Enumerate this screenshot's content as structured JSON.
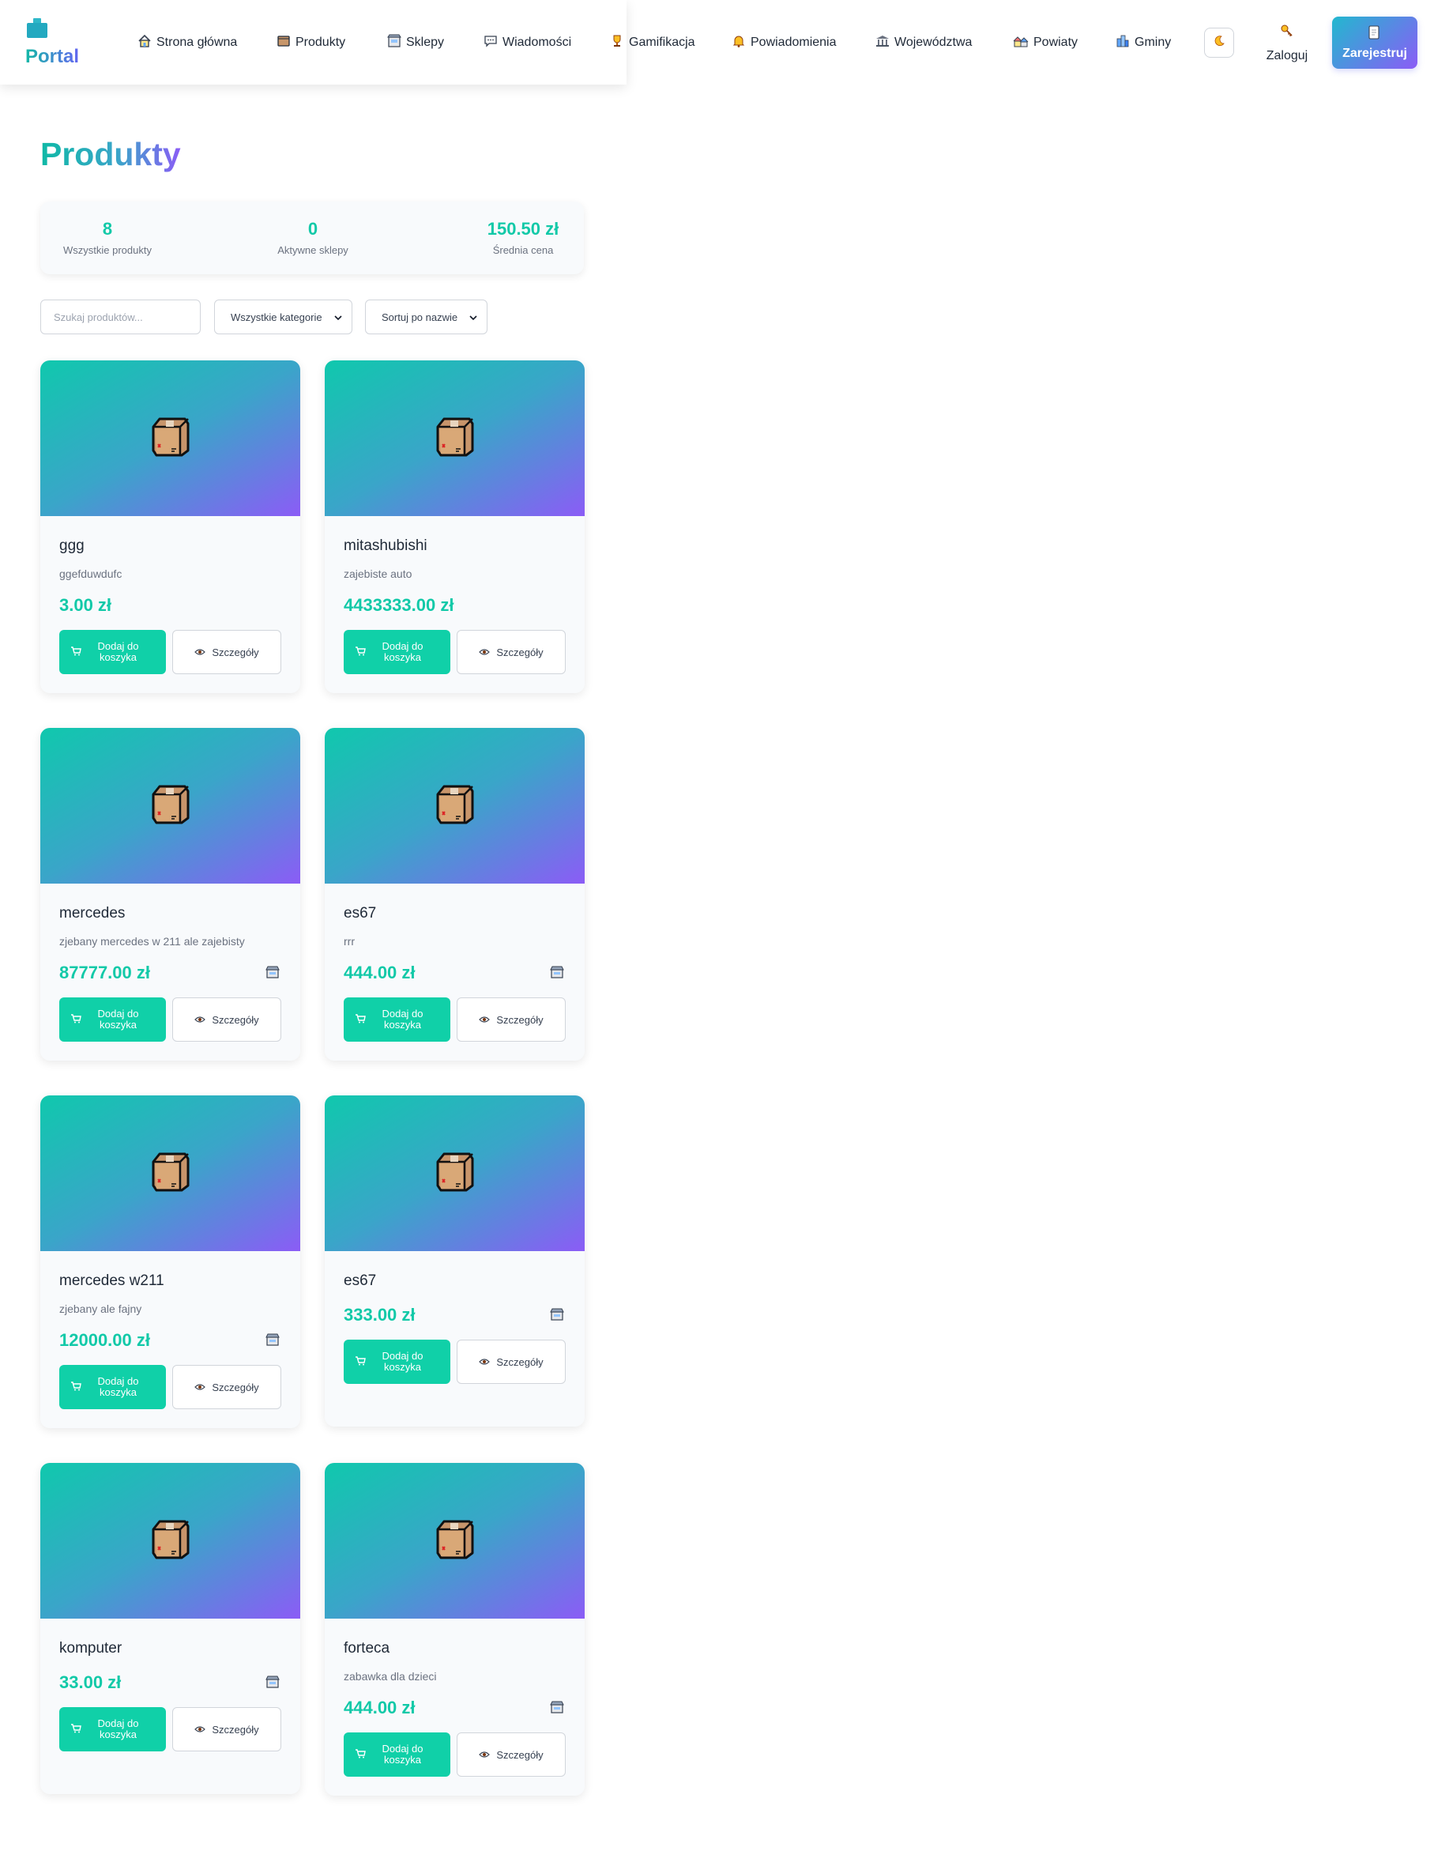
{
  "header": {
    "logo_text": "Portal",
    "nav": [
      {
        "label": "Strona główna",
        "icon": "home-icon"
      },
      {
        "label": "Produkty",
        "icon": "package-icon"
      },
      {
        "label": "Sklepy",
        "icon": "shop-icon"
      },
      {
        "label": "Wiadomości",
        "icon": "chat-icon"
      },
      {
        "label": "Gamifikacja",
        "icon": "trophy-icon"
      },
      {
        "label": "Powiadomienia",
        "icon": "bell-icon"
      },
      {
        "label": "Województwa",
        "icon": "bank-icon"
      },
      {
        "label": "Powiaty",
        "icon": "houses-icon"
      },
      {
        "label": "Gminy",
        "icon": "city-icon"
      }
    ],
    "theme_icon": "moon-icon",
    "login_label": "Zaloguj",
    "register_label": "Zarejestruj"
  },
  "page": {
    "title": "Produkty"
  },
  "stats": [
    {
      "value": "8",
      "label": "Wszystkie produkty"
    },
    {
      "value": "0",
      "label": "Aktywne sklepy"
    },
    {
      "value": "150.50 zł",
      "label": "Średnia cena"
    }
  ],
  "filters": {
    "search_placeholder": "Szukaj produktów...",
    "category_selected": "Wszystkie kategorie",
    "sort_selected": "Sortuj po nazwie"
  },
  "card_labels": {
    "add_to_cart": "Dodaj do koszyka",
    "details": "Szczegóły"
  },
  "products": [
    {
      "name": "ggg",
      "description": "ggefduwdufc",
      "price": "3.00 zł",
      "shop_icon": false
    },
    {
      "name": "mitashubishi",
      "description": "zajebiste auto",
      "price": "4433333.00 zł",
      "shop_icon": false
    },
    {
      "name": "mercedes",
      "description": "zjebany mercedes w 211 ale zajebisty",
      "price": "87777.00 zł",
      "shop_icon": true
    },
    {
      "name": "es67",
      "description": "rrr",
      "price": "444.00 zł",
      "shop_icon": true
    },
    {
      "name": "mercedes w211",
      "description": "zjebany ale fajny",
      "price": "12000.00 zł",
      "shop_icon": true
    },
    {
      "name": "es67",
      "description": "",
      "price": "333.00 zł",
      "shop_icon": true
    },
    {
      "name": "komputer",
      "description": "",
      "price": "33.00 zł",
      "shop_icon": true
    },
    {
      "name": "forteca",
      "description": "zabawka dla dzieci",
      "price": "444.00 zł",
      "shop_icon": true
    }
  ]
}
